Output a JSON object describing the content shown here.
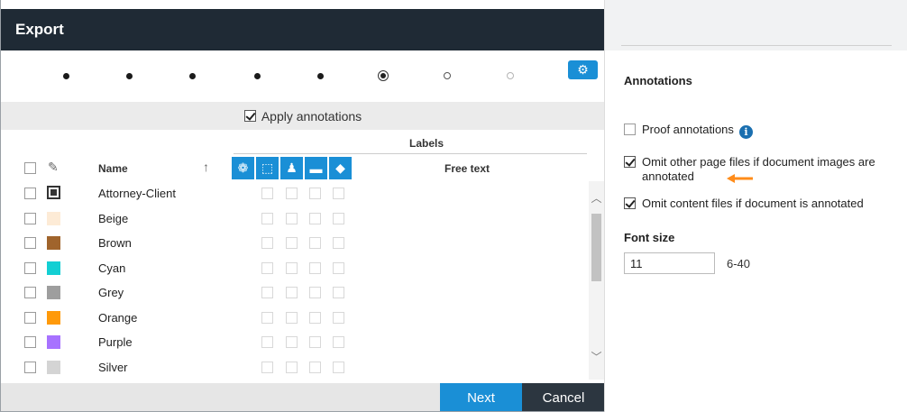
{
  "dialog": {
    "title": "Export",
    "apply_annotations_label": "Apply annotations",
    "labels_heading": "Labels",
    "columns": {
      "name": "Name",
      "free_text": "Free text"
    },
    "rows": [
      {
        "name": "Attorney-Client",
        "swatch": "tag-icon"
      },
      {
        "name": "Beige",
        "swatch": "#fdebd6"
      },
      {
        "name": "Brown",
        "swatch": "#a0642c"
      },
      {
        "name": "Cyan",
        "swatch": "#13cfd3"
      },
      {
        "name": "Grey",
        "swatch": "#9e9e9e"
      },
      {
        "name": "Orange",
        "swatch": "#ff9a0a"
      },
      {
        "name": "Purple",
        "swatch": "#a772ff"
      },
      {
        "name": "Silver",
        "swatch": "#d4d4d4"
      }
    ],
    "buttons": {
      "next": "Next",
      "cancel": "Cancel"
    }
  },
  "panel": {
    "title": "Annotations",
    "proof_annotations": "Proof annotations",
    "omit_page_files_line1": "Omit other page files if document images are",
    "omit_page_files_line2": "annotated",
    "omit_content_files": "Omit content files if document is annotated",
    "font_size_label": "Font size",
    "font_size_value": "11",
    "font_size_range": "6-40"
  },
  "colors": {
    "accent": "#1a8fd6",
    "titlebar": "#1f2a35",
    "arrow": "#ff8c1a"
  }
}
